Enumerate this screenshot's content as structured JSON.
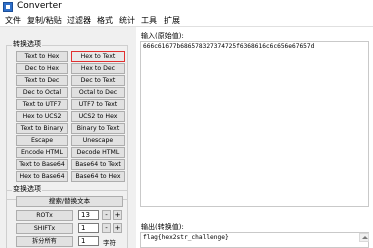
{
  "window": {
    "title": "Converter"
  },
  "menu": [
    "文件",
    "复制/粘贴",
    "过滤器",
    "格式",
    "统计",
    "工具",
    "扩展"
  ],
  "conversion_group": {
    "title": "转换选项",
    "buttons": [
      [
        "Text to Hex",
        "Hex to Text"
      ],
      [
        "Dec to Hex",
        "Hex to Dec"
      ],
      [
        "Text to Dec",
        "Dec to Text"
      ],
      [
        "Dec to Octal",
        "Octal to Dec"
      ],
      [
        "Text to UTF7",
        "UTF7 to Text"
      ],
      [
        "Hex to UCS2",
        "UCS2 to Hex"
      ],
      [
        "Text to Binary",
        "Binary to Text"
      ],
      [
        "Escape",
        "Unescape"
      ],
      [
        "Encode HTML",
        "Decode HTML"
      ],
      [
        "Text to Base64",
        "Base64 to Text"
      ],
      [
        "Hex to Base64",
        "Base64 to Hex"
      ]
    ],
    "selected": "Hex to Text"
  },
  "transform_group": {
    "title": "变换选项",
    "search_replace": "搜索/替换文本",
    "rot": {
      "label": "ROTx",
      "value": "13",
      "minus": "-",
      "plus": "+"
    },
    "shift": {
      "label": "SHIFTx",
      "value": "1",
      "minus": "-",
      "plus": "+"
    },
    "split": {
      "label": "拆分所有",
      "value": "1",
      "suffix": "字符"
    }
  },
  "input": {
    "label": "输入(原始值):",
    "value": "666c61677b686578327374725f6368616c6c656e67657d"
  },
  "output": {
    "label": "输出(转换值):",
    "value": "flag{hex2str_challenge}"
  },
  "icons": {
    "app": "converter-app-icon",
    "scroll_up": "chevron-up-icon",
    "scroll_down": "chevron-down-icon"
  },
  "colors": {
    "selected_border": "#e03030",
    "panel": "#f0f0f0",
    "button": "#e1e1e1"
  }
}
